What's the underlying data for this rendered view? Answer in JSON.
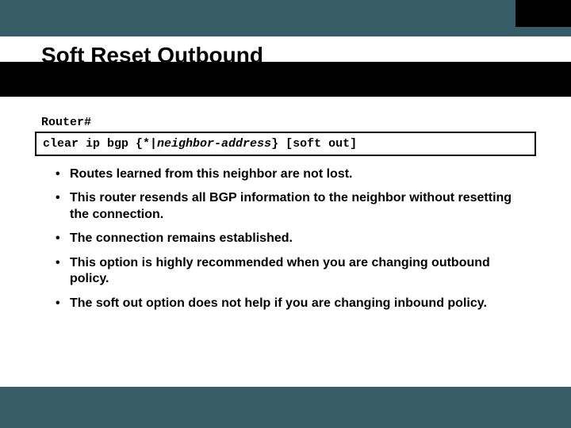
{
  "title": "Soft Reset Outbound",
  "prompt": "Router#",
  "command": {
    "pre": "clear ip bgp {*|",
    "italic": "neighbor-address",
    "post": "} [soft out]"
  },
  "bullets": [
    "Routes learned from this neighbor are not lost.",
    "This router resends all BGP information to the neighbor without resetting the connection.",
    "The connection remains established.",
    "This option is highly recommended when you are changing outbound policy.",
    "The soft out option does not help if you are changing inbound policy."
  ]
}
